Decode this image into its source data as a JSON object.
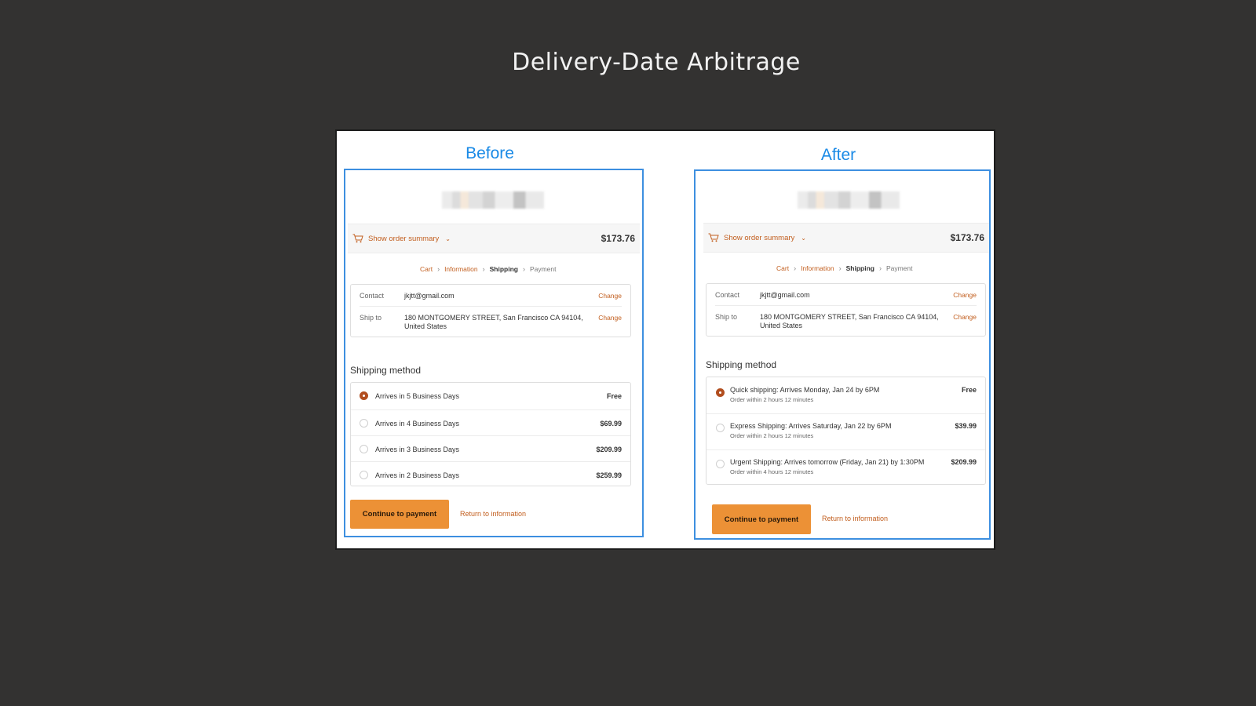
{
  "slide": {
    "title": "Delivery-Date Arbitrage"
  },
  "before": {
    "label": "Before",
    "summary": {
      "toggle_label": "Show order summary",
      "total": "$173.76"
    },
    "breadcrumb": [
      "Cart",
      "Information",
      "Shipping",
      "Payment"
    ],
    "contact": {
      "key": "Contact",
      "value": "jkjtt@gmail.com",
      "change": "Change"
    },
    "ship_to": {
      "key": "Ship to",
      "line1": "180 MONTGOMERY STREET, San Francisco CA 94104,",
      "line2": "United States",
      "change": "Change"
    },
    "section_title": "Shipping method",
    "methods": [
      {
        "label": "Arrives in 5 Business Days",
        "price": "Free",
        "selected": true
      },
      {
        "label": "Arrives in 4 Business Days",
        "price": "$69.99",
        "selected": false
      },
      {
        "label": "Arrives in 3 Business Days",
        "price": "$209.99",
        "selected": false
      },
      {
        "label": "Arrives in 2 Business Days",
        "price": "$259.99",
        "selected": false
      }
    ],
    "continue_label": "Continue to payment",
    "return_label": "Return to information"
  },
  "after": {
    "label": "After",
    "summary": {
      "toggle_label": "Show order summary",
      "total": "$173.76"
    },
    "breadcrumb": [
      "Cart",
      "Information",
      "Shipping",
      "Payment"
    ],
    "contact": {
      "key": "Contact",
      "value": "jkjtt@gmail.com",
      "change": "Change"
    },
    "ship_to": {
      "key": "Ship to",
      "line1": "180 MONTGOMERY STREET, San Francisco CA 94104,",
      "line2": "United States",
      "change": "Change"
    },
    "section_title": "Shipping method",
    "methods": [
      {
        "label": "Quick shipping: Arrives Monday, Jan 24 by 6PM",
        "sub": "Order within 2 hours 12 minutes",
        "price": "Free",
        "selected": true
      },
      {
        "label": "Express Shipping: Arrives Saturday, Jan 22 by 6PM",
        "sub": "Order within 2 hours 12 minutes",
        "price": "$39.99",
        "selected": false
      },
      {
        "label": "Urgent Shipping: Arrives tomorrow (Friday, Jan 21) by 1:30PM",
        "sub": "Order within 4 hours 12 minutes",
        "price": "$209.99",
        "selected": false
      }
    ],
    "continue_label": "Continue to payment",
    "return_label": "Return to information"
  },
  "colors": {
    "accent": "#c25e1e",
    "button": "#ec9136",
    "panel_border": "#3d8fe0",
    "label_blue": "#1a8ae6",
    "background": "#333231"
  },
  "icons": {
    "cart": "cart-icon",
    "chevron": "chevron-down-icon",
    "breadcrumb_separator": "chevron-right-icon"
  }
}
